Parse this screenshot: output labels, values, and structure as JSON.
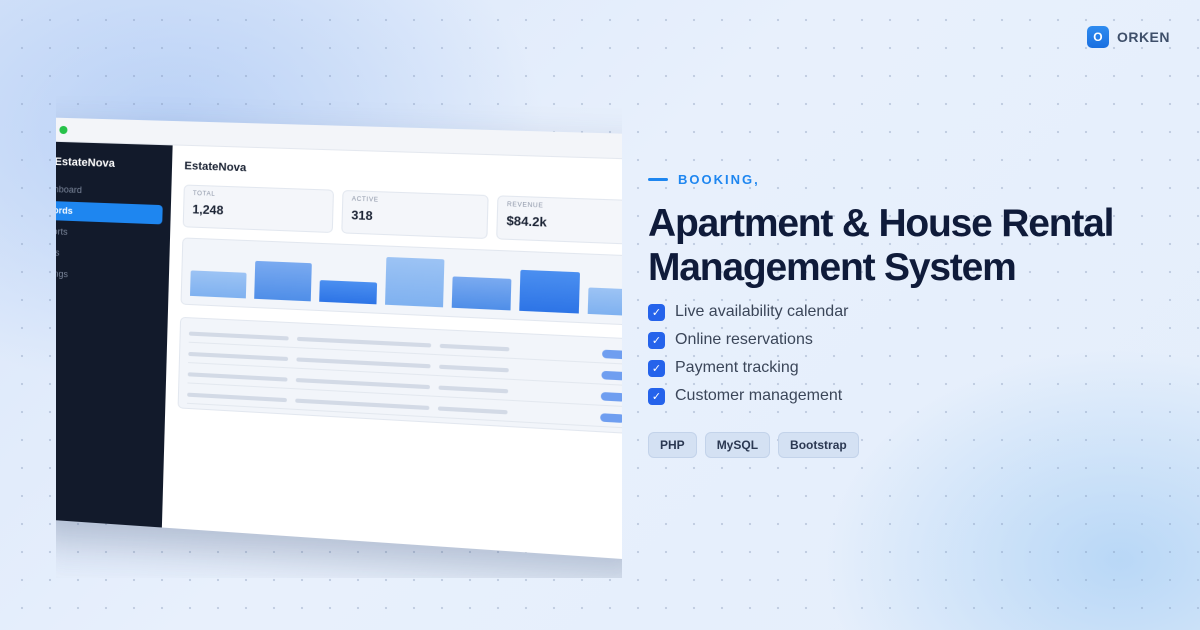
{
  "brand": {
    "logo_letter": "O",
    "name": "ORKEN"
  },
  "app": {
    "sidebar_brand": "EstateNova",
    "title": "EstateNova",
    "nav": [
      {
        "label": "hboard"
      },
      {
        "label": "ords"
      },
      {
        "label": "orts"
      },
      {
        "label": "rs"
      },
      {
        "label": "ings"
      }
    ],
    "stats": [
      {
        "label": "TOTAL",
        "value": "1,248"
      },
      {
        "label": "ACTIVE",
        "value": "318"
      },
      {
        "label": "REVENUE",
        "value": "$84.2k"
      }
    ],
    "chart_bars": [
      0.55,
      0.8,
      0.45,
      1.0,
      0.65,
      0.85,
      0.55
    ],
    "table_rows": 4
  },
  "hero": {
    "eyebrow": "BOOKING,",
    "headline_line1": "Apartment & House Rental",
    "headline_line2": "Management System",
    "features": [
      "Live availability calendar",
      "Online reservations",
      "Payment tracking",
      "Customer management"
    ],
    "tags": [
      "PHP",
      "MySQL",
      "Bootstrap"
    ]
  },
  "colors": {
    "accent": "#1e86f0",
    "headline": "#0f1b3a",
    "sidebar": "#121a2b",
    "check": "#2563eb"
  },
  "icons": {
    "feature_check": "check-icon"
  }
}
